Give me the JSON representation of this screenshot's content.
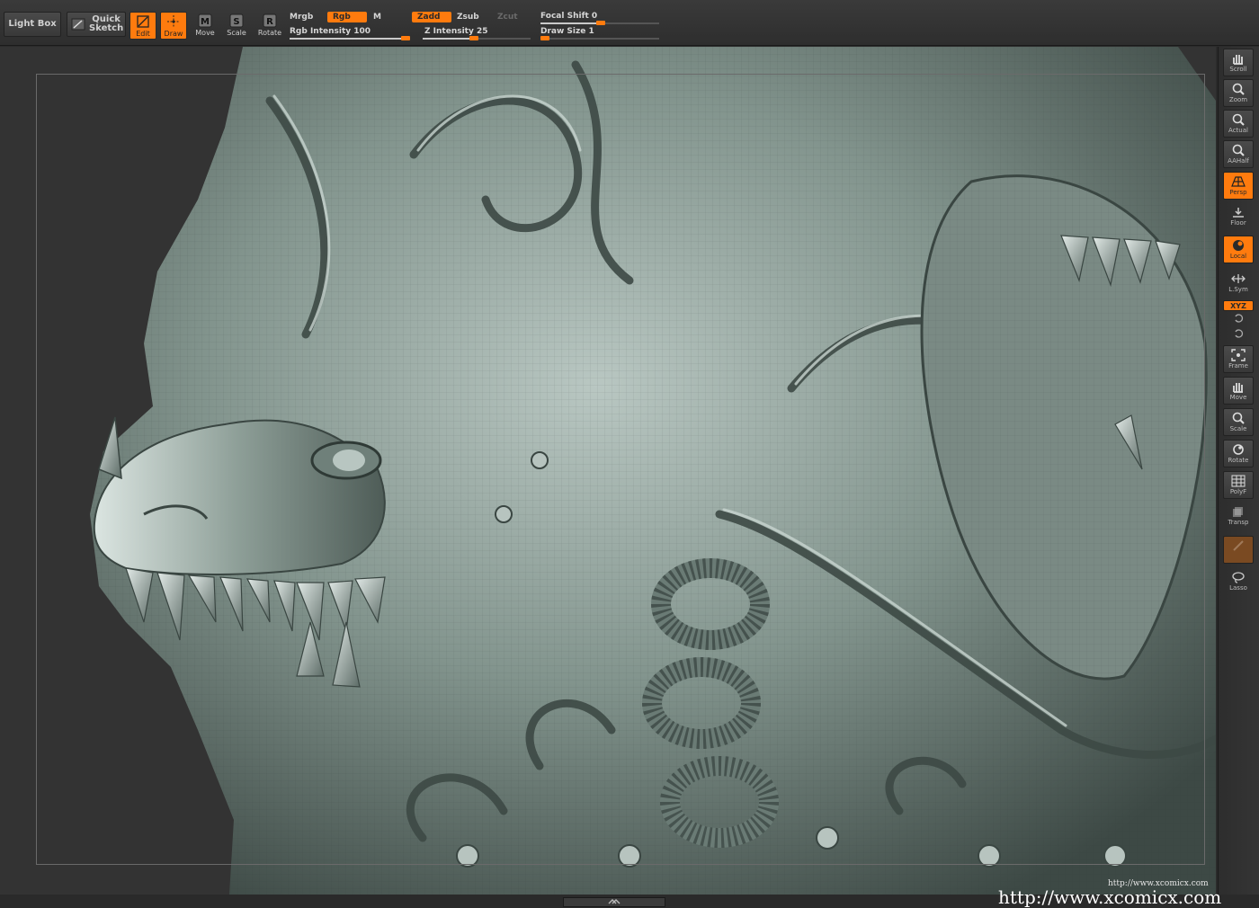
{
  "toolbar": {
    "lightbox_label": "Light Box",
    "quick_sketch_line1": "Quick",
    "quick_sketch_line2": "Sketch",
    "tools": [
      {
        "label": "Edit",
        "icon": "edit-icon",
        "active": true
      },
      {
        "label": "Draw",
        "icon": "draw-icon",
        "active": true
      },
      {
        "label": "Move",
        "icon": "move-icon",
        "active": false
      },
      {
        "label": "Scale",
        "icon": "scale-icon",
        "active": false
      },
      {
        "label": "Rotate",
        "icon": "rotate-icon",
        "active": false
      }
    ],
    "mrgb_label": "Mrgb",
    "rgb_label": "Rgb",
    "m_label": "M",
    "zadd_label": "Zadd",
    "zsub_label": "Zsub",
    "zcut_label": "Zcut",
    "rgb_intensity_label": "Rgb Intensity 100",
    "z_intensity_label": "Z Intensity 25",
    "focal_shift_label": "Focal Shift 0",
    "draw_size_label": "Draw Size 1",
    "rgb_intensity": 100,
    "z_intensity": 25,
    "focal_shift": 0,
    "draw_size": 1
  },
  "shelf": {
    "buttons": [
      {
        "label": "Scroll",
        "icon": "hand-icon",
        "state": "normal"
      },
      {
        "label": "Zoom",
        "icon": "magnifier-icon",
        "state": "normal"
      },
      {
        "label": "Actual",
        "icon": "magnifier-icon",
        "state": "normal"
      },
      {
        "label": "AAHalf",
        "icon": "magnifier-icon",
        "state": "normal"
      },
      {
        "label": "Persp",
        "icon": "perspective-grid-icon",
        "state": "on"
      },
      {
        "label": "Floor",
        "icon": "floor-icon",
        "state": "ghost"
      },
      {
        "label": "Local",
        "icon": "local-sphere-icon",
        "state": "on"
      },
      {
        "label": "L.Sym",
        "icon": "symmetry-icon",
        "state": "ghost"
      },
      {
        "label": "XYZ",
        "icon": "xyz-icon",
        "state": "on"
      },
      {
        "label": "Frame",
        "icon": "frame-icon",
        "state": "normal"
      },
      {
        "label": "Move",
        "icon": "hand-icon",
        "state": "normal"
      },
      {
        "label": "Scale",
        "icon": "magnifier-icon",
        "state": "normal"
      },
      {
        "label": "Rotate",
        "icon": "rotate-icon",
        "state": "normal"
      },
      {
        "label": "PolyF",
        "icon": "polyframe-icon",
        "state": "normal"
      },
      {
        "label": "Transp",
        "icon": "transparency-icon",
        "state": "ghost"
      },
      {
        "label": "",
        "icon": "ghost-icon",
        "state": "disabled"
      },
      {
        "label": "Lasso",
        "icon": "lasso-icon",
        "state": "ghost"
      }
    ]
  },
  "canvas": {
    "subject": "sculpted-dragon-relief",
    "colors": {
      "sculpt_base": "#7f9089",
      "sculpt_light": "#c6d2cd",
      "sculpt_dark": "#3e4a45",
      "accent": "#ff7b0e"
    }
  },
  "watermark": {
    "small": "http://www.xcomicx.com",
    "large": "http://www.xcomicx.com"
  }
}
